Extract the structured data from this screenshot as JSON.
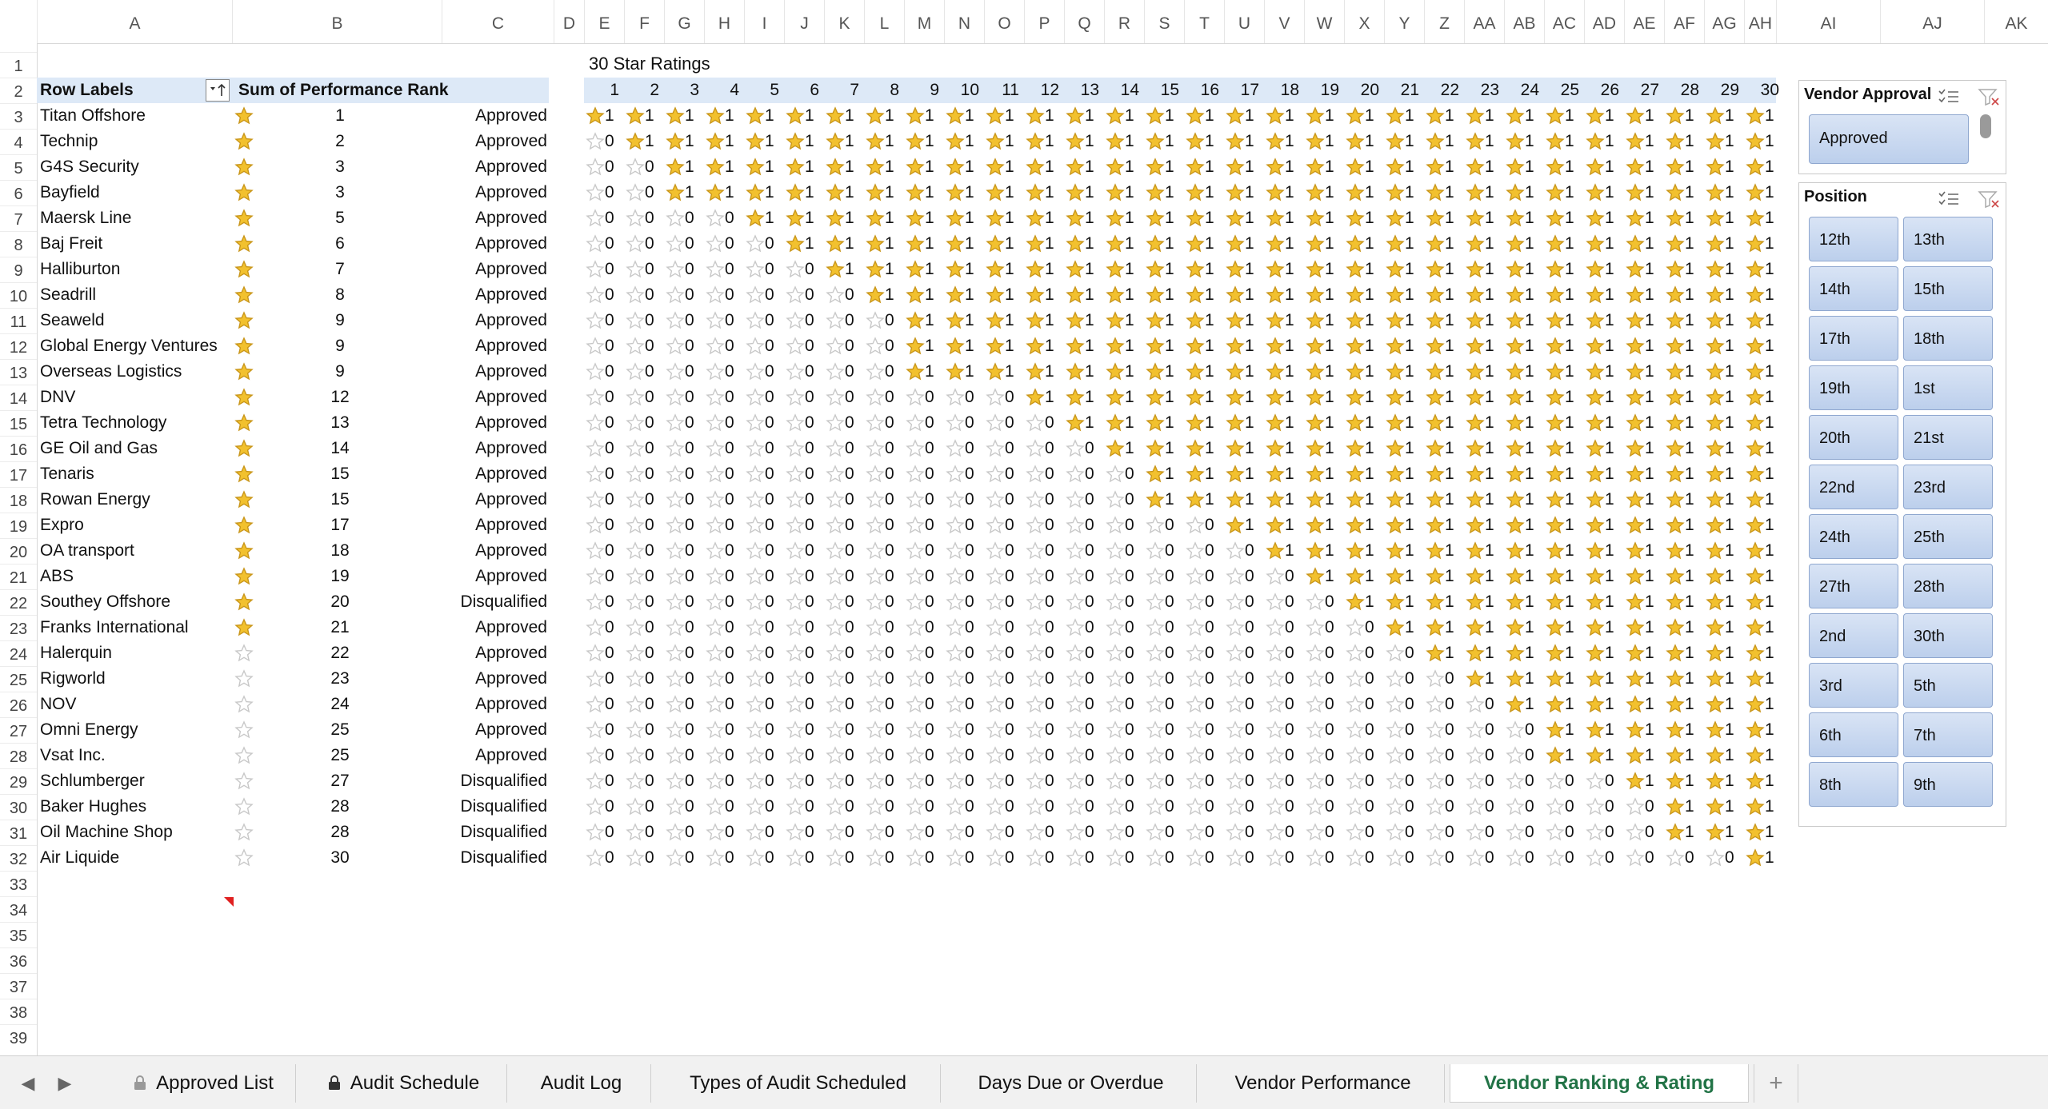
{
  "columns": [
    "A",
    "B",
    "C",
    "D",
    "E",
    "F",
    "G",
    "H",
    "I",
    "J",
    "K",
    "L",
    "M",
    "N",
    "O",
    "P",
    "Q",
    "R",
    "S",
    "T",
    "U",
    "V",
    "W",
    "X",
    "Y",
    "Z",
    "AA",
    "AB",
    "AC",
    "AD",
    "AE",
    "AF",
    "AG",
    "AH",
    "AI",
    "AJ",
    "AK"
  ],
  "row_numbers": [
    "1",
    "2",
    "3",
    "4",
    "5",
    "6",
    "7",
    "8",
    "9",
    "10",
    "11",
    "12",
    "13",
    "14",
    "15",
    "16",
    "17",
    "18",
    "19",
    "20",
    "21",
    "22",
    "23",
    "24",
    "25",
    "26",
    "27",
    "28",
    "29",
    "30",
    "31",
    "32",
    "33",
    "34",
    "35",
    "36",
    "37",
    "38",
    "39"
  ],
  "pivot": {
    "header_row_labels": "Row Labels",
    "header_sum": "Sum of Performance Rank",
    "rows": [
      {
        "name": "Titan Offshore",
        "rank": "1",
        "status": "Approved"
      },
      {
        "name": "Technip",
        "rank": "2",
        "status": "Approved"
      },
      {
        "name": "G4S Security",
        "rank": "3",
        "status": "Approved"
      },
      {
        "name": "Bayfield",
        "rank": "3",
        "status": "Approved"
      },
      {
        "name": "Maersk Line",
        "rank": "5",
        "status": "Approved"
      },
      {
        "name": "Baj Freit",
        "rank": "6",
        "status": "Approved"
      },
      {
        "name": "Halliburton",
        "rank": "7",
        "status": "Approved"
      },
      {
        "name": "Seadrill",
        "rank": "8",
        "status": "Approved"
      },
      {
        "name": "Seaweld",
        "rank": "9",
        "status": "Approved"
      },
      {
        "name": "Global Energy Ventures",
        "rank": "9",
        "status": "Approved"
      },
      {
        "name": "Overseas Logistics",
        "rank": "9",
        "status": "Approved"
      },
      {
        "name": "DNV",
        "rank": "12",
        "status": "Approved"
      },
      {
        "name": "Tetra Technology",
        "rank": "13",
        "status": "Approved"
      },
      {
        "name": "GE Oil and Gas",
        "rank": "14",
        "status": "Approved"
      },
      {
        "name": "Tenaris",
        "rank": "15",
        "status": "Approved"
      },
      {
        "name": "Rowan Energy",
        "rank": "15",
        "status": "Approved"
      },
      {
        "name": "Expro",
        "rank": "17",
        "status": "Approved"
      },
      {
        "name": "OA transport",
        "rank": "18",
        "status": "Approved"
      },
      {
        "name": "ABS",
        "rank": "19",
        "status": "Approved"
      },
      {
        "name": "Southey Offshore",
        "rank": "20",
        "status": "Disqualified"
      },
      {
        "name": "Franks International",
        "rank": "21",
        "status": "Approved"
      },
      {
        "name": "Halerquin",
        "rank": "22",
        "status": "Approved"
      },
      {
        "name": "Rigworld",
        "rank": "23",
        "status": "Approved"
      },
      {
        "name": "NOV",
        "rank": "24",
        "status": "Approved"
      },
      {
        "name": "Omni Energy",
        "rank": "25",
        "status": "Approved"
      },
      {
        "name": "Vsat Inc.",
        "rank": "25",
        "status": "Approved"
      },
      {
        "name": "Schlumberger",
        "rank": "27",
        "status": "Disqualified"
      },
      {
        "name": "Baker Hughes",
        "rank": "28",
        "status": "Disqualified"
      },
      {
        "name": "Oil Machine Shop",
        "rank": "28",
        "status": "Disqualified"
      },
      {
        "name": "Air Liquide",
        "rank": "30",
        "status": "Disqualified"
      }
    ]
  },
  "ratings": {
    "title": "30 Star Ratings",
    "headers": [
      "1",
      "2",
      "3",
      "4",
      "5",
      "6",
      "7",
      "8",
      "9",
      "10",
      "11",
      "12",
      "13",
      "14",
      "15",
      "16",
      "17",
      "18",
      "19",
      "20",
      "21",
      "22",
      "23",
      "24",
      "25",
      "26",
      "27",
      "28",
      "29",
      "30"
    ],
    "filled_value": "1",
    "empty_value": "0"
  },
  "slicers": {
    "vendor_approval": {
      "title": "Vendor Approval",
      "items": [
        "Approved"
      ]
    },
    "position": {
      "title": "Position",
      "items": [
        "12th",
        "13th",
        "14th",
        "15th",
        "17th",
        "18th",
        "19th",
        "1st",
        "20th",
        "21st",
        "22nd",
        "23rd",
        "24th",
        "25th",
        "27th",
        "28th",
        "2nd",
        "30th",
        "3rd",
        "5th",
        "6th",
        "7th",
        "8th",
        "9th"
      ]
    }
  },
  "tabs": [
    "Approved List",
    "Audit Schedule",
    "Audit Log",
    "Types of Audit Scheduled",
    "Days Due or Overdue",
    "Vendor Performance",
    "Vendor Ranking & Rating"
  ],
  "colors": {
    "star_filled": "#f2c12e",
    "star_empty": "#c8c8c8",
    "header_band": "#dde9f7",
    "active_tab": "#217346",
    "slicer_button": "#c9d8f0"
  },
  "add_tab_label": "+"
}
